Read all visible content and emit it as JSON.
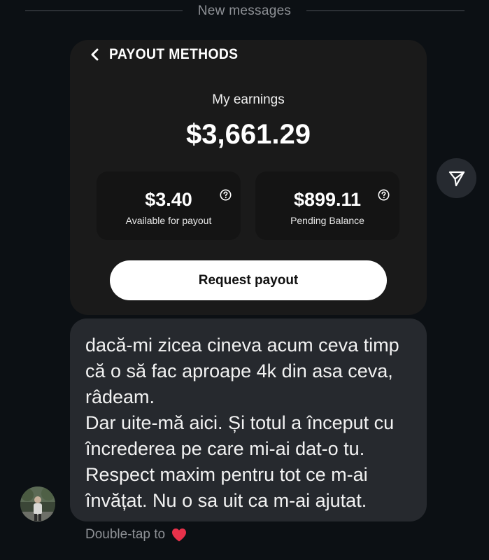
{
  "divider": {
    "label": "New messages"
  },
  "shared_card": {
    "title": "PAYOUT METHODS",
    "earnings_label": "My earnings",
    "earnings_amount": "$3,661.29",
    "stats": [
      {
        "value": "$3.40",
        "caption": "Available for payout",
        "icon": "help-circle-icon"
      },
      {
        "value": "$899.11",
        "caption": "Pending Balance",
        "icon": "help-circle-icon"
      }
    ],
    "request_button_label": "Request payout"
  },
  "message": {
    "paragraphs": [
      "dacă-mi zicea cineva acum ceva timp că o să fac aproape 4k din asa ceva, râdeam.",
      "Dar uite-mă aici. Și totul a început cu încrederea pe care mi-ai dat-o tu. Respect maxim pentru tot ce m-ai învățat. Nu o sa uit ca m-ai ajutat."
    ]
  },
  "reaction_hint": {
    "label": "Double-tap to",
    "icon": "heart-icon"
  },
  "icons": {
    "back": "chevron-left-icon",
    "share": "send-icon",
    "avatar": "avatar"
  },
  "colors": {
    "background": "#0c1014",
    "card": "#1a1a1a",
    "bubble": "#26292e",
    "heart": "#e8314a"
  }
}
